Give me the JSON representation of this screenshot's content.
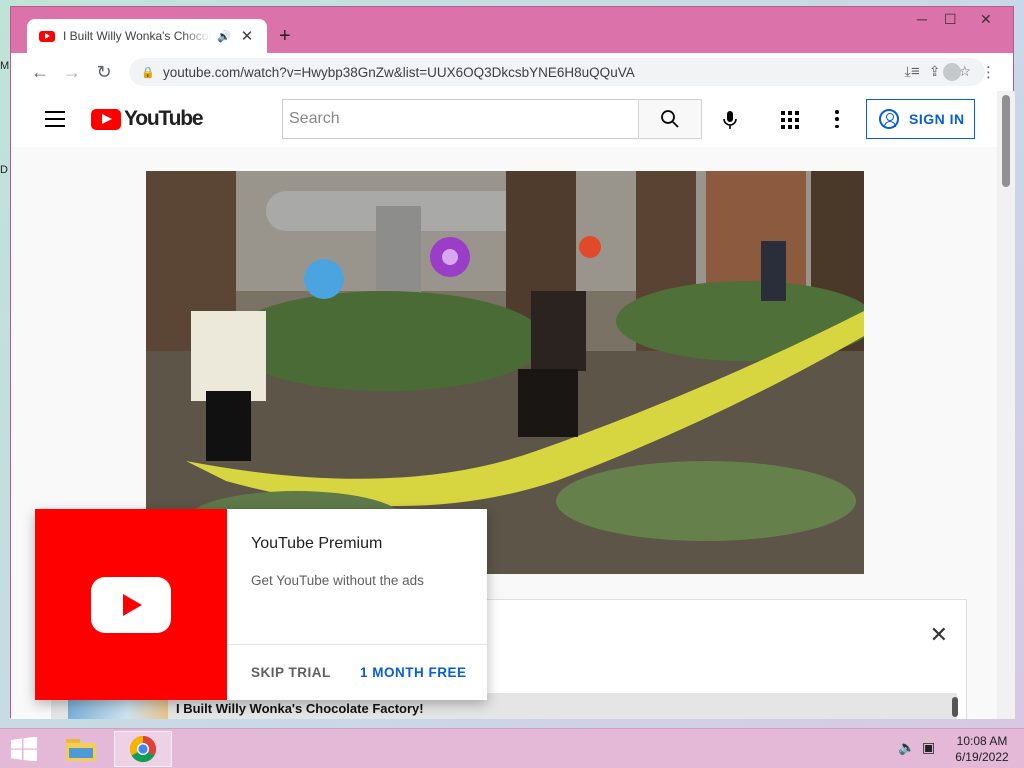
{
  "desktop": {
    "icon_letters": [
      "M",
      "D"
    ]
  },
  "browser": {
    "tab": {
      "title": "I Built Willy Wonka's Chocolate Factory!",
      "audio_icon": "speaker-icon",
      "close_icon": "close-icon"
    },
    "new_tab_icon": "plus-icon",
    "window_controls": [
      "minimize-icon",
      "maximize-icon",
      "close-icon"
    ],
    "nav": [
      "back-arrow-icon",
      "forward-arrow-icon",
      "reload-icon"
    ],
    "url": "youtube.com/watch?v=Hwybp38GnZw&list=UUX6OQ3DkcsbYNE6H8uQQuVA",
    "omnibox_icons": [
      "install-icon",
      "share-icon",
      "bookmark-star-icon"
    ],
    "toolbar_icons": [
      "reading-list-icon",
      "profile-icon",
      "menu-dots-icon"
    ]
  },
  "youtube": {
    "logo_text": "YouTube",
    "search_placeholder": "Search",
    "sign_in_label": "SIGN IN",
    "video_list_title": "I Built Willy Wonka's Chocolate Factory!"
  },
  "promo": {
    "title": "YouTube Premium",
    "subtitle": "Get YouTube without the ads",
    "skip_label": "SKIP TRIAL",
    "cta_label": "1 MONTH FREE"
  },
  "taskbar": {
    "apps": [
      "file-explorer-icon",
      "chrome-icon"
    ],
    "tray_icons": [
      "volume-muted-icon",
      "network-icon"
    ],
    "time": "10:08 AM",
    "date": "6/19/2022"
  },
  "colors": {
    "youtube_red": "#ff0000",
    "link_blue": "#065fd4",
    "window_frame": "#db72a9"
  }
}
